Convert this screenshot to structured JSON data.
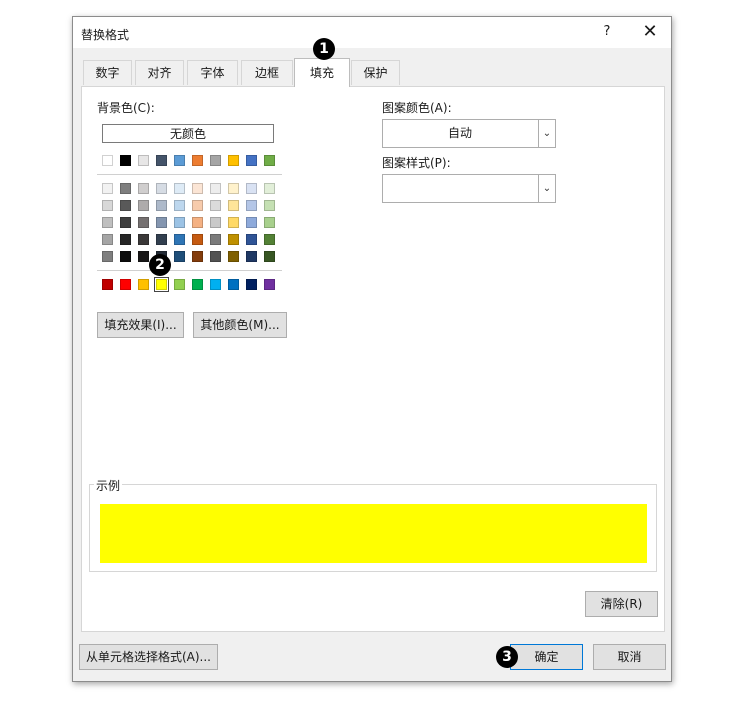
{
  "dialog": {
    "title": "替换格式",
    "help": "?",
    "close": "✕"
  },
  "tabs": [
    {
      "label": "数字",
      "active": false
    },
    {
      "label": "对齐",
      "active": false
    },
    {
      "label": "字体",
      "active": false
    },
    {
      "label": "边框",
      "active": false
    },
    {
      "label": "填充",
      "active": true
    },
    {
      "label": "保护",
      "active": false
    }
  ],
  "fill": {
    "background_label": "背景色(C):",
    "no_color_label": "无颜色",
    "standard_row": [
      "#ffffff",
      "#000000",
      "#e7e6e6",
      "#44546a",
      "#5b9bd5",
      "#ed7d31",
      "#a5a5a5",
      "#ffc000",
      "#4472c4",
      "#70ad47"
    ],
    "theme_rows": [
      [
        "#f2f2f2",
        "#7f7f7f",
        "#d0cece",
        "#d6dce4",
        "#deebf6",
        "#fbe5d5",
        "#ededed",
        "#fff2cc",
        "#d9e2f3",
        "#e2efd9"
      ],
      [
        "#d8d8d8",
        "#595959",
        "#aeabab",
        "#adb9ca",
        "#bdd7ee",
        "#f7cbac",
        "#dbdbdb",
        "#fee599",
        "#b4c6e7",
        "#c5e0b3"
      ],
      [
        "#bfbfbf",
        "#3f3f3f",
        "#757070",
        "#8496b0",
        "#9cc3e5",
        "#f4b183",
        "#c9c9c9",
        "#ffd965",
        "#8eaadb",
        "#a8d08d"
      ],
      [
        "#a5a5a5",
        "#262626",
        "#3a3838",
        "#323f4f",
        "#2e75b5",
        "#c55a11",
        "#7b7b7b",
        "#bf9000",
        "#2f5496",
        "#538135"
      ],
      [
        "#7f7f7f",
        "#0c0c0c",
        "#171616",
        "#222a35",
        "#1e4e79",
        "#833c0b",
        "#525252",
        "#7f6000",
        "#1f3864",
        "#375623"
      ]
    ],
    "bright_row": [
      "#c00000",
      "#ff0000",
      "#ffc000",
      "#ffff00",
      "#92d050",
      "#00b050",
      "#00b0f0",
      "#0070c0",
      "#002060",
      "#7030a0"
    ],
    "selected_index": 3,
    "fill_effects_label": "填充效果(I)...",
    "more_colors_label": "其他颜色(M)...",
    "pattern_color_label": "图案颜色(A):",
    "pattern_color_value": "自动",
    "pattern_style_label": "图案样式(P):",
    "pattern_style_value": "",
    "sample_label": "示例",
    "sample_color": "#ffff00",
    "clear_label": "清除(R)"
  },
  "footer": {
    "choose_from_cell_label": "从单元格选择格式(A)...",
    "ok_label": "确定",
    "cancel_label": "取消"
  },
  "annotations": [
    "1",
    "2",
    "3"
  ]
}
